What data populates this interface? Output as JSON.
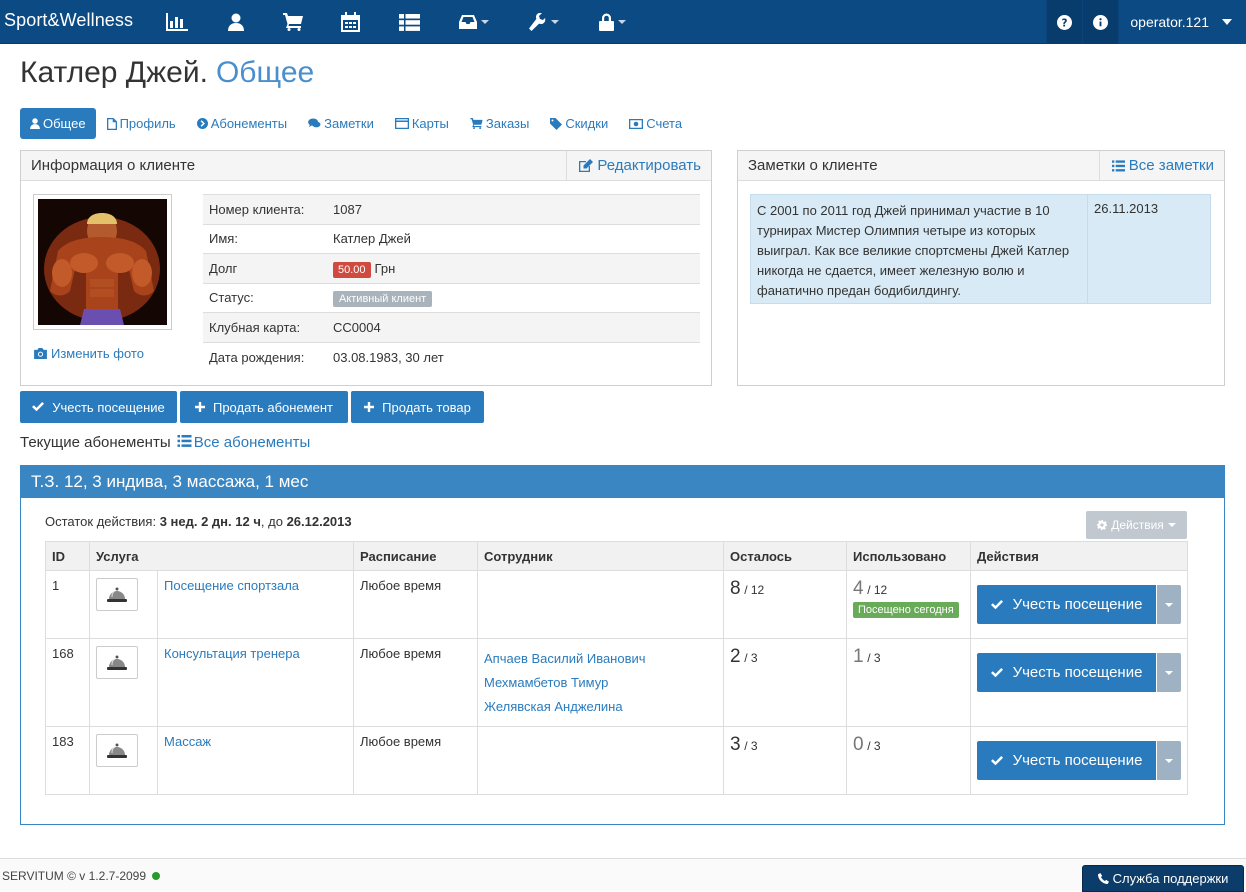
{
  "navbar": {
    "brand": "Sport&Wellness",
    "icons": [
      "bar-chart-icon",
      "user-icon",
      "cart-icon",
      "calendar-icon",
      "list-icon",
      "inbox-icon",
      "wrench-icon",
      "lock-icon"
    ],
    "user": "operator.121"
  },
  "page": {
    "title": "Катлер Джей.",
    "subtitle": "Общее"
  },
  "tabs": [
    {
      "label": "Общее",
      "active": true
    },
    {
      "label": "Профиль"
    },
    {
      "label": "Абонементы"
    },
    {
      "label": "Заметки"
    },
    {
      "label": "Карты"
    },
    {
      "label": "Заказы"
    },
    {
      "label": "Скидки"
    },
    {
      "label": "Счета"
    }
  ],
  "client_info": {
    "header": "Информация о клиенте",
    "edit_label": "Редактировать",
    "change_photo": "Изменить фото",
    "rows": [
      {
        "key": "Номер клиента:",
        "value": "1087"
      },
      {
        "key": "Имя:",
        "value": "Катлер Джей"
      },
      {
        "key": "Долг",
        "badge": "50.00",
        "value": "Грн"
      },
      {
        "key": "Статус:",
        "badge": "Активный клиент"
      },
      {
        "key": "Клубная карта:",
        "value": "CC0004"
      },
      {
        "key": "Дата рождения:",
        "value": "03.08.1983, 30 лет"
      }
    ]
  },
  "notes": {
    "header": "Заметки о клиенте",
    "all_label": "Все заметки",
    "text": "С 2001 по 2011 год Джей принимал участие в 10 турнирах Мистер Олимпия четыре из которых выиграл. Как все великие спортсмены Джей Катлер никогда не сдается, имеет железную волю и фанатично предан бодибилдингу.",
    "date": "26.11.2013"
  },
  "actions": {
    "visit": "Учесть посещение",
    "sell_sub": "Продать абонемент",
    "sell_item": "Продать товар"
  },
  "current_subs": {
    "label": "Текущие абонементы",
    "all_label": "Все абонементы"
  },
  "subscription": {
    "title": "Т.З. 12, 3 индива, 3 массажа, 1 мес",
    "remain_prefix": "Остаток действия:",
    "remain_value": "3 нед. 2 дн. 12 ч",
    "remain_mid": ", до",
    "remain_date": "26.12.2013",
    "actions_dd": "Действия",
    "columns": [
      "ID",
      "Услуга",
      "Расписание",
      "Сотрудник",
      "Осталось",
      "Использовано",
      "Действия"
    ],
    "rows": [
      {
        "id": "1",
        "service": "Посещение спортзала",
        "schedule": "Любое время",
        "staff": [],
        "left": "8",
        "left_total": "/ 12",
        "used": "4",
        "used_total": "/ 12",
        "badge": "Посещено сегодня",
        "btn": "Учесть посещение"
      },
      {
        "id": "168",
        "service": "Консультация тренера",
        "schedule": "Любое время",
        "staff": [
          "Апчаев Василий Иванович",
          "Мехмамбетов Тимур",
          "Желявская Анджелина"
        ],
        "left": "2",
        "left_total": "/ 3",
        "used": "1",
        "used_total": "/ 3",
        "btn": "Учесть посещение"
      },
      {
        "id": "183",
        "service": "Массаж",
        "schedule": "Любое время",
        "staff": [],
        "left": "3",
        "left_total": "/ 3",
        "used": "0",
        "used_total": "/ 3",
        "btn": "Учесть посещение"
      }
    ]
  },
  "footer": {
    "version": "SERVITUM © v 1.2.7-2099",
    "support": "Служба поддержки"
  }
}
